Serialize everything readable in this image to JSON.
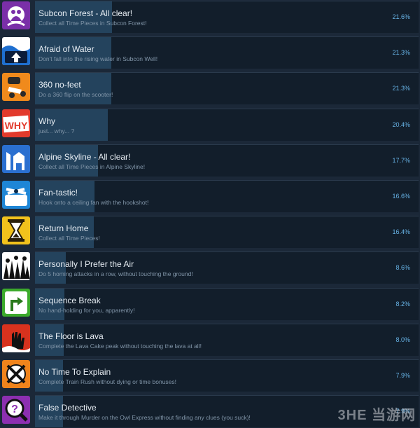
{
  "achievements": [
    {
      "title": "Subcon Forest - All clear!",
      "description": "Collect all Time Pieces in Subcon Forest!",
      "percent": "21.6%",
      "unlock_fraction": 0.216,
      "icon": "subcon-forest-icon",
      "icon_bg": "#7a2fa8"
    },
    {
      "title": "Afraid of Water",
      "description": "Don't fall into the rising water in Subcon Well!",
      "percent": "21.3%",
      "unlock_fraction": 0.213,
      "icon": "water-up-arrow-icon",
      "icon_bg": "#2a7bd0"
    },
    {
      "title": "360 no-feet",
      "description": "Do a 360 flip on the scooter!",
      "percent": "21.3%",
      "unlock_fraction": 0.213,
      "icon": "scooter-flip-icon",
      "icon_bg": "#f08a1c"
    },
    {
      "title": "Why",
      "description": "just... why... ?",
      "percent": "20.4%",
      "unlock_fraction": 0.204,
      "icon": "why-sign-icon",
      "icon_bg": "#e23a2c"
    },
    {
      "title": "Alpine Skyline - All clear!",
      "description": "Collect all Time Pieces in Alpine Skyline!",
      "percent": "17.7%",
      "unlock_fraction": 0.177,
      "icon": "alpine-skyline-icon",
      "icon_bg": "#2a6fd0"
    },
    {
      "title": "Fan-tastic!",
      "description": "Hook onto a ceiling fan with the hookshot!",
      "percent": "16.6%",
      "unlock_fraction": 0.166,
      "icon": "ceiling-fan-icon",
      "icon_bg": "#1e86d6"
    },
    {
      "title": "Return Home",
      "description": "Collect all Time Pieces!",
      "percent": "16.4%",
      "unlock_fraction": 0.164,
      "icon": "hourglass-icon",
      "icon_bg": "#f2c21c"
    },
    {
      "title": "Personally I Prefer the Air",
      "description": "Do 5 homing attacks in a row, without touching the ground!",
      "percent": "8.6%",
      "unlock_fraction": 0.086,
      "icon": "crowd-icon",
      "icon_bg": "#3a8a2c"
    },
    {
      "title": "Sequence Break",
      "description": "No hand-holding for you, apparently!",
      "percent": "8.2%",
      "unlock_fraction": 0.082,
      "icon": "turn-right-arrow-icon",
      "icon_bg": "#3caa2c"
    },
    {
      "title": "The Floor is Lava",
      "description": "Complete the Lava Cake peak without touching the lava at all!",
      "percent": "8.0%",
      "unlock_fraction": 0.08,
      "icon": "lava-hand-icon",
      "icon_bg": "#d8321e"
    },
    {
      "title": "No Time To Explain",
      "description": "Complete Train Rush without dying or time bonuses!",
      "percent": "7.9%",
      "unlock_fraction": 0.079,
      "icon": "crossed-clock-icon",
      "icon_bg": "#f0841c"
    },
    {
      "title": "False Detective",
      "description": "Make it through Murder on the Owl Express without finding any clues (you suck)!",
      "percent": "7.9%",
      "unlock_fraction": 0.079,
      "icon": "question-magnifier-icon",
      "icon_bg": "#8c2fb0"
    }
  ],
  "watermark": "3HE 当游网",
  "colors": {
    "background": "#1b2838",
    "panel": "#121e2b",
    "bar": "#24435d",
    "percent": "#67b3e6"
  }
}
